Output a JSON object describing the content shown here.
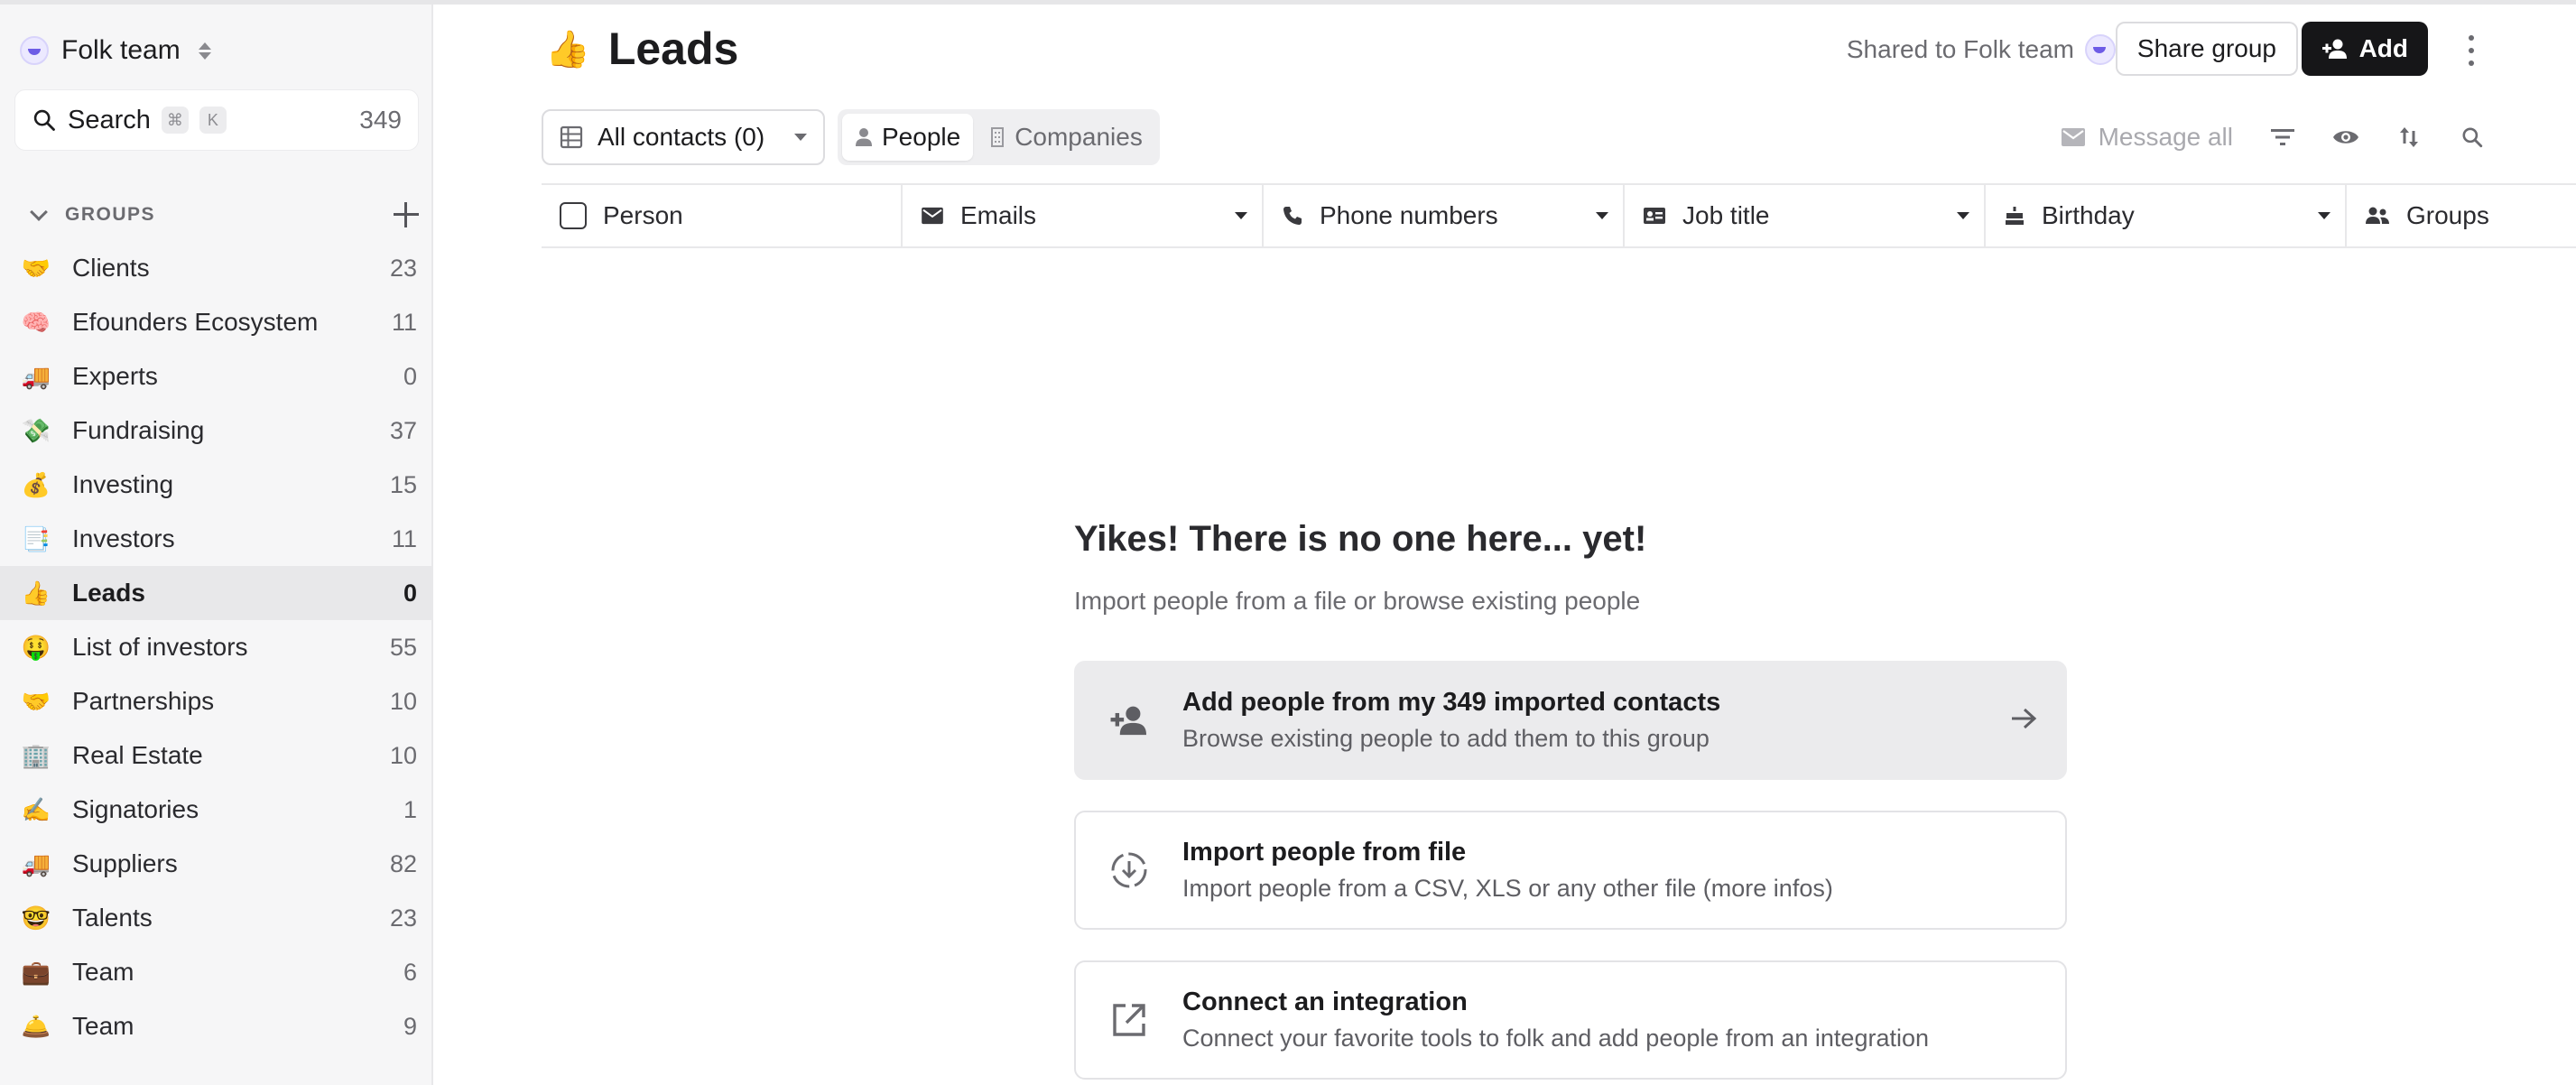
{
  "sidebar": {
    "workspace_name": "Folk team",
    "search": {
      "label": "Search",
      "shortcut_mod": "⌘",
      "shortcut_key": "K",
      "count": "349"
    },
    "groups_title": "GROUPS",
    "groups": [
      {
        "emoji": "🤝",
        "name": "Clients",
        "count": "23"
      },
      {
        "emoji": "🧠",
        "name": "Efounders Ecosystem",
        "count": "11"
      },
      {
        "emoji": "🚚",
        "name": "Experts",
        "count": "0"
      },
      {
        "emoji": "💸",
        "name": "Fundraising",
        "count": "37"
      },
      {
        "emoji": "💰",
        "name": "Investing",
        "count": "15"
      },
      {
        "emoji": "📑",
        "name": "Investors",
        "count": "11"
      },
      {
        "emoji": "👍",
        "name": "Leads",
        "count": "0",
        "active": true
      },
      {
        "emoji": "🤑",
        "name": "List of investors",
        "count": "55"
      },
      {
        "emoji": "🤝",
        "name": "Partnerships",
        "count": "10"
      },
      {
        "emoji": "🏢",
        "name": "Real Estate",
        "count": "10"
      },
      {
        "emoji": "✍️",
        "name": "Signatories",
        "count": "1"
      },
      {
        "emoji": "🚚",
        "name": "Suppliers",
        "count": "82"
      },
      {
        "emoji": "🤓",
        "name": "Talents",
        "count": "23"
      },
      {
        "emoji": "💼",
        "name": "Team",
        "count": "6"
      },
      {
        "emoji": "🛎️",
        "name": "Team",
        "count": "9"
      }
    ]
  },
  "header": {
    "emoji": "👍",
    "title": "Leads",
    "shared_text": "Shared to Folk team",
    "share_button": "Share group",
    "add_button": "Add"
  },
  "toolbar": {
    "view_label": "All contacts (0)",
    "segments": {
      "people": "People",
      "companies": "Companies",
      "active": "People"
    },
    "message_all": "Message all"
  },
  "table": {
    "columns": [
      {
        "label": "Person",
        "icon": "checkbox"
      },
      {
        "label": "Emails",
        "icon": "mail-icon"
      },
      {
        "label": "Phone numbers",
        "icon": "phone-icon"
      },
      {
        "label": "Job title",
        "icon": "id-card-icon"
      },
      {
        "label": "Birthday",
        "icon": "cake-icon"
      },
      {
        "label": "Groups",
        "icon": "people-icon"
      }
    ]
  },
  "empty_state": {
    "title": "Yikes! There is no one here... yet!",
    "subtitle": "Import people from a file or browse existing people",
    "cards": [
      {
        "title": "Add people from my 349 imported contacts",
        "desc": "Browse existing people to add them to this group"
      },
      {
        "title": "Import people from file",
        "desc": "Import people from a CSV, XLS or any other file (more infos)"
      },
      {
        "title": "Connect an integration",
        "desc": "Connect your favorite tools to folk and add people from an integration"
      }
    ]
  },
  "colors": {
    "accent": "#6d5ce6",
    "primary_button": "#161618",
    "sidebar_bg": "#f6f6f7"
  }
}
